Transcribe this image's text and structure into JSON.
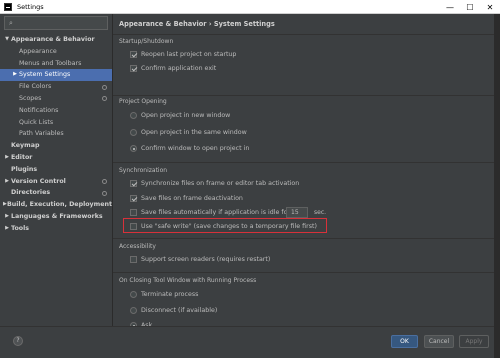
{
  "window": {
    "title": "Settings",
    "controls": [
      "—",
      "☐",
      "✕"
    ]
  },
  "search": {
    "placeholder": "",
    "icon": "search-icon"
  },
  "sidebar": {
    "items": [
      {
        "label": "Appearance & Behavior",
        "arrow": "▼",
        "level": 0,
        "bold": true
      },
      {
        "label": "Appearance",
        "arrow": "",
        "level": 1
      },
      {
        "label": "Menus and Toolbars",
        "arrow": "",
        "level": 1
      },
      {
        "label": "System Settings",
        "arrow": "▶",
        "level": 1,
        "selected": true
      },
      {
        "label": "File Colors",
        "arrow": "",
        "level": 1,
        "project_icon": true
      },
      {
        "label": "Scopes",
        "arrow": "",
        "level": 1,
        "project_icon": true
      },
      {
        "label": "Notifications",
        "arrow": "",
        "level": 1
      },
      {
        "label": "Quick Lists",
        "arrow": "",
        "level": 1
      },
      {
        "label": "Path Variables",
        "arrow": "",
        "level": 1
      },
      {
        "label": "Keymap",
        "arrow": "",
        "level": 0,
        "bold": true
      },
      {
        "label": "Editor",
        "arrow": "▶",
        "level": 0,
        "bold": true
      },
      {
        "label": "Plugins",
        "arrow": "",
        "level": 0,
        "bold": true
      },
      {
        "label": "Version Control",
        "arrow": "▶",
        "level": 0,
        "bold": true,
        "project_icon": true
      },
      {
        "label": "Directories",
        "arrow": "",
        "level": 0,
        "bold": true,
        "project_icon": true
      },
      {
        "label": "Build, Execution, Deployment",
        "arrow": "▶",
        "level": 0,
        "bold": true
      },
      {
        "label": "Languages & Frameworks",
        "arrow": "▶",
        "level": 0,
        "bold": true
      },
      {
        "label": "Tools",
        "arrow": "▶",
        "level": 0,
        "bold": true
      }
    ]
  },
  "content": {
    "breadcrumb": "Appearance & Behavior › System Settings",
    "startup": {
      "title": "Startup/Shutdown",
      "reopen_last_project": {
        "label": "Reopen last project on startup",
        "checked": true
      },
      "confirm_exit": {
        "label": "Confirm application exit",
        "checked": true
      }
    },
    "project_opening": {
      "title": "Project Opening",
      "options": [
        {
          "label": "Open project in new window",
          "checked": false
        },
        {
          "label": "Open project in the same window",
          "checked": false
        },
        {
          "label": "Confirm window to open project in",
          "checked": true
        }
      ]
    },
    "synchronization": {
      "title": "Synchronization",
      "sync_on_activation": {
        "label": "Synchronize files on frame or editor tab activation",
        "checked": true
      },
      "save_on_deactivation": {
        "label": "Save files on frame deactivation",
        "checked": true
      },
      "save_if_idle": {
        "label": "Save files automatically if application is idle for",
        "checked": false,
        "value": "15",
        "unit": "sec."
      },
      "safe_write": {
        "label": "Use \"safe write\" (save changes to a temporary file first)",
        "checked": false
      }
    },
    "accessibility": {
      "title": "Accessibility",
      "screen_readers": {
        "label": "Support screen readers (requires restart)",
        "checked": false
      }
    },
    "closing_tool_window": {
      "title": "On Closing Tool Window with Running Process",
      "options": [
        {
          "label": "Terminate process",
          "checked": false
        },
        {
          "label": "Disconnect (if available)",
          "checked": false
        },
        {
          "label": "Ask",
          "checked": true
        }
      ]
    }
  },
  "footer": {
    "help": "?",
    "ok": "OK",
    "cancel": "Cancel",
    "apply": "Apply"
  },
  "colors": {
    "background": "#3c3f41",
    "selection": "#4b6eaf",
    "primary_button": "#365880",
    "highlight_border": "#d8313a"
  }
}
